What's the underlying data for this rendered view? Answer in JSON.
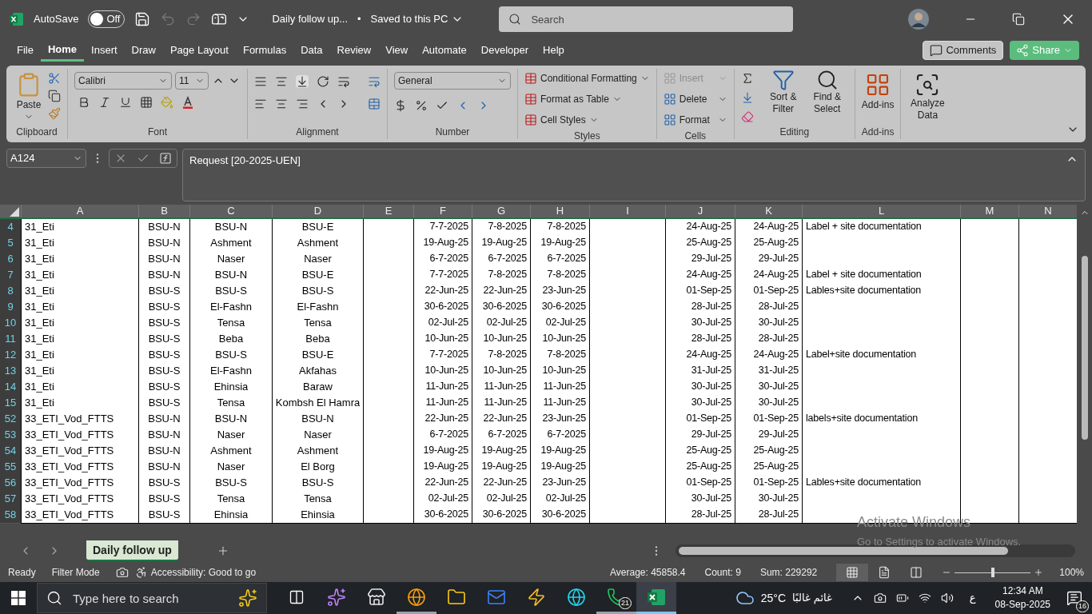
{
  "title_bar": {
    "autosave_label": "AutoSave",
    "autosave": {
      "on": false,
      "label": "Off"
    },
    "title": "Daily follow up...",
    "separator": "•",
    "save_status": "Saved to this PC",
    "search": {
      "placeholder": "Search"
    }
  },
  "menu_tabs": [
    {
      "label": "File",
      "selected": false
    },
    {
      "label": "Home",
      "selected": true
    },
    {
      "label": "Insert",
      "selected": false
    },
    {
      "label": "Draw",
      "selected": false
    },
    {
      "label": "Page Layout",
      "selected": false
    },
    {
      "label": "Formulas",
      "selected": false
    },
    {
      "label": "Data",
      "selected": false
    },
    {
      "label": "Review",
      "selected": false
    },
    {
      "label": "View",
      "selected": false
    },
    {
      "label": "Automate",
      "selected": false
    },
    {
      "label": "Developer",
      "selected": false
    },
    {
      "label": "Help",
      "selected": false
    }
  ],
  "comments": "Comments",
  "share": "Share",
  "ribbon": {
    "clipboard": {
      "label": "Clipboard",
      "paste": "Paste"
    },
    "font": {
      "label": "Font",
      "family": "Calibri",
      "size": "11"
    },
    "alignment": {
      "label": "Alignment"
    },
    "number": {
      "label": "Number",
      "format": "General"
    },
    "styles": {
      "label": "Styles",
      "items": [
        "Conditional Formatting",
        "Format as Table",
        "Cell Styles"
      ]
    },
    "cells": {
      "label": "Cells",
      "items": [
        {
          "label": "Insert",
          "disabled": true
        },
        {
          "label": "Delete",
          "disabled": false
        },
        {
          "label": "Format",
          "disabled": false
        }
      ]
    },
    "editing": {
      "label": "Editing",
      "sort": "Sort & Filter",
      "find": "Find & Select"
    },
    "addins": {
      "label": "Add-ins",
      "button": "Add-ins"
    },
    "analyze": "Analyze Data"
  },
  "formula_bar": {
    "name_box": "A124",
    "formula": "Request [20-2025-UEN]"
  },
  "columns": [
    "A",
    "B",
    "C",
    "D",
    "E",
    "F",
    "G",
    "H",
    "I",
    "J",
    "K",
    "L",
    "M",
    "N"
  ],
  "rows": [
    {
      "number": "4",
      "cells": [
        "31_Eti",
        "BSU-N",
        "BSU-N",
        "BSU-E",
        null,
        "7-7-2025",
        "7-8-2025",
        "7-8-2025",
        null,
        "24-Aug-25",
        "24-Aug-25",
        "Label + site documentation",
        null,
        null
      ]
    },
    {
      "number": "5",
      "cells": [
        "31_Eti",
        "BSU-N",
        "Ashment",
        "Ashment",
        null,
        "19-Aug-25",
        "19-Aug-25",
        "19-Aug-25",
        null,
        "25-Aug-25",
        "25-Aug-25",
        null,
        null,
        null
      ]
    },
    {
      "number": "6",
      "cells": [
        "31_Eti",
        "BSU-N",
        "Naser",
        "Naser",
        null,
        "6-7-2025",
        "6-7-2025",
        "6-7-2025",
        null,
        "29-Jul-25",
        "29-Jul-25",
        null,
        null,
        null
      ]
    },
    {
      "number": "7",
      "cells": [
        "31_Eti",
        "BSU-N",
        "BSU-N",
        "BSU-E",
        null,
        "7-7-2025",
        "7-8-2025",
        "7-8-2025",
        null,
        "24-Aug-25",
        "24-Aug-25",
        "Label + site documentation",
        null,
        null
      ]
    },
    {
      "number": "8",
      "cells": [
        "31_Eti",
        "BSU-S",
        "BSU-S",
        "BSU-S",
        null,
        "22-Jun-25",
        "22-Jun-25",
        "23-Jun-25",
        null,
        "01-Sep-25",
        "01-Sep-25",
        "Lables+site documentation",
        null,
        null
      ]
    },
    {
      "number": "9",
      "cells": [
        "31_Eti",
        "BSU-S",
        "El-Fashn",
        "El-Fashn",
        null,
        "30-6-2025",
        "30-6-2025",
        "30-6-2025",
        null,
        "28-Jul-25",
        "28-Jul-25",
        null,
        null,
        null
      ]
    },
    {
      "number": "10",
      "cells": [
        "31_Eti",
        "BSU-S",
        "Tensa",
        "Tensa",
        null,
        "02-Jul-25",
        "02-Jul-25",
        "02-Jul-25",
        null,
        "30-Jul-25",
        "30-Jul-25",
        null,
        null,
        null
      ]
    },
    {
      "number": "11",
      "cells": [
        "31_Eti",
        "BSU-S",
        "Beba",
        "Beba",
        null,
        "10-Jun-25",
        "10-Jun-25",
        "10-Jun-25",
        null,
        "28-Jul-25",
        "28-Jul-25",
        null,
        null,
        null
      ]
    },
    {
      "number": "12",
      "cells": [
        "31_Eti",
        "BSU-S",
        "BSU-S",
        "BSU-E",
        null,
        "7-7-2025",
        "7-8-2025",
        "7-8-2025",
        null,
        "24-Aug-25",
        "24-Aug-25",
        "Label+site documentation",
        null,
        null
      ]
    },
    {
      "number": "13",
      "cells": [
        "31_Eti",
        "BSU-S",
        "El-Fashn",
        "Akfahas",
        null,
        "10-Jun-25",
        "10-Jun-25",
        "10-Jun-25",
        null,
        "31-Jul-25",
        "31-Jul-25",
        null,
        null,
        null
      ]
    },
    {
      "number": "14",
      "cells": [
        "31_Eti",
        "BSU-S",
        "Ehinsia",
        "Baraw",
        null,
        "11-Jun-25",
        "11-Jun-25",
        "11-Jun-25",
        null,
        "30-Jul-25",
        "30-Jul-25",
        null,
        null,
        null
      ]
    },
    {
      "number": "15",
      "cells": [
        "31_Eti",
        "BSU-S",
        "Tensa",
        "Kombsh El Hamra",
        null,
        "11-Jun-25",
        "11-Jun-25",
        "11-Jun-25",
        null,
        "30-Jul-25",
        "30-Jul-25",
        null,
        null,
        null
      ]
    },
    {
      "number": "52",
      "cells": [
        "33_ETI_Vod_FTTS",
        "BSU-N",
        "BSU-N",
        "BSU-N",
        null,
        "22-Jun-25",
        "22-Jun-25",
        "23-Jun-25",
        null,
        "01-Sep-25",
        "01-Sep-25",
        "labels+site documentation",
        null,
        null
      ]
    },
    {
      "number": "53",
      "cells": [
        "33_ETI_Vod_FTTS",
        "BSU-N",
        "Naser",
        "Naser",
        null,
        "6-7-2025",
        "6-7-2025",
        "6-7-2025",
        null,
        "29-Jul-25",
        "29-Jul-25",
        null,
        null,
        null
      ]
    },
    {
      "number": "54",
      "cells": [
        "33_ETI_Vod_FTTS",
        "BSU-N",
        "Ashment",
        "Ashment",
        null,
        "19-Aug-25",
        "19-Aug-25",
        "19-Aug-25",
        null,
        "25-Aug-25",
        "25-Aug-25",
        null,
        null,
        null
      ]
    },
    {
      "number": "55",
      "cells": [
        "33_ETI_Vod_FTTS",
        "BSU-N",
        "Naser",
        "El Borg",
        null,
        "19-Aug-25",
        "19-Aug-25",
        "19-Aug-25",
        null,
        "25-Aug-25",
        "25-Aug-25",
        null,
        null,
        null
      ]
    },
    {
      "number": "56",
      "cells": [
        "33_ETI_Vod_FTTS",
        "BSU-S",
        "BSU-S",
        "BSU-S",
        null,
        "22-Jun-25",
        "22-Jun-25",
        "23-Jun-25",
        null,
        "01-Sep-25",
        "01-Sep-25",
        "Lables+site documentation",
        null,
        null
      ]
    },
    {
      "number": "57",
      "cells": [
        "33_ETI_Vod_FTTS",
        "BSU-S",
        "Tensa",
        "Tensa",
        null,
        "02-Jul-25",
        "02-Jul-25",
        "02-Jul-25",
        null,
        "30-Jul-25",
        "30-Jul-25",
        null,
        null,
        null
      ]
    },
    {
      "number": "58",
      "cells": [
        "33_ETI_Vod_FTTS",
        "BSU-S",
        "Ehinsia",
        "Ehinsia",
        null,
        "30-6-2025",
        "30-6-2025",
        "30-6-2025",
        null,
        "28-Jul-25",
        "28-Jul-25",
        null,
        null,
        null
      ]
    }
  ],
  "sheet_tabs": [
    {
      "label": "Daily follow up",
      "selected": true
    }
  ],
  "activation": {
    "title": "Activate Windows",
    "hint": "Go to Settings to activate Windows."
  },
  "status_bar": {
    "mode": "Ready",
    "filter": "Filter Mode",
    "accessibility": "Accessibility: Good to go",
    "stats": [
      "Average: 45858.4",
      "Count: 9",
      "Sum: 229292"
    ],
    "views": [
      {
        "kind": "normal",
        "selected": true
      },
      {
        "kind": "page-layout",
        "selected": false
      },
      {
        "kind": "page-break",
        "selected": false
      }
    ],
    "zoom": {
      "level": 0.5,
      "label": "100%"
    }
  },
  "taskbar": {
    "search": {
      "placeholder": "Type here to search"
    },
    "apps": [
      {
        "kind": "task-view",
        "running": false,
        "selected": false
      },
      {
        "kind": "copilot",
        "running": false,
        "selected": false
      },
      {
        "kind": "store",
        "running": false,
        "selected": false
      },
      {
        "kind": "chrome",
        "running": true,
        "selected": false
      },
      {
        "kind": "folder",
        "running": false,
        "selected": false
      },
      {
        "kind": "outlook",
        "running": false,
        "selected": false
      },
      {
        "kind": "bolt",
        "running": false,
        "selected": false
      },
      {
        "kind": "edge",
        "running": false,
        "selected": false
      },
      {
        "kind": "whatsapp",
        "running": true,
        "selected": false,
        "badge": "21"
      },
      {
        "kind": "excel",
        "running": true,
        "selected": true
      }
    ],
    "weather": {
      "temperature": "25°C",
      "condition": "غائم غالبًا"
    },
    "language": "ع",
    "time": "12:34 AM",
    "date": "08-Sep-2025",
    "notifications": "16"
  }
}
